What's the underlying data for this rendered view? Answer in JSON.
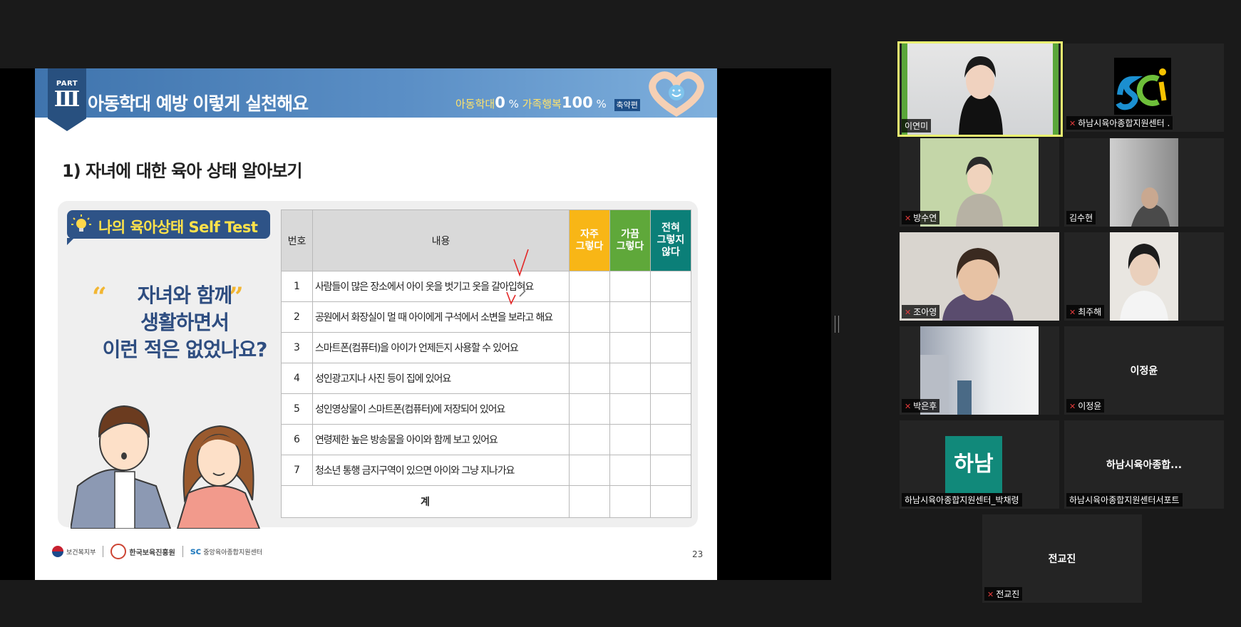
{
  "slide": {
    "part_label": "PART",
    "part_number": "Ⅲ",
    "title": "아동학대 예방 이렇게 실천해요",
    "motto": {
      "term1": "아동학대",
      "value1": "0",
      "unit1": "%",
      "term2": "가족행복",
      "value2": "100",
      "unit2": "%",
      "tag": "축약편"
    },
    "section_title": "1) 자녀에 대한 육아 상태 알아보기",
    "badge_text": "나의 육아상태 Self Test",
    "quote_lines": [
      "자녀와 함께",
      "생활하면서",
      "이런 적은 없었나요?"
    ],
    "quote_open": "“",
    "quote_close": "”",
    "table": {
      "col_number": "번호",
      "col_content": "내용",
      "col_often_1": "자주",
      "col_often_2": "그렇다",
      "col_sometimes_1": "가끔",
      "col_sometimes_2": "그렇다",
      "col_never_1": "전혀",
      "col_never_2": "그렇지",
      "col_never_3": "않다",
      "rows": [
        {
          "num": "1",
          "text": "사람들이 많은 장소에서 아이 옷을 벗기고 옷을 갈아입혀요"
        },
        {
          "num": "2",
          "text": "공원에서 화장실이 멀 때 아이에게 구석에서 소변을 보라고 해요"
        },
        {
          "num": "3",
          "text": "스마트폰(컴퓨터)을 아이가 언제든지 사용할 수 있어요"
        },
        {
          "num": "4",
          "text": "성인광고지나 사진 등이 집에 있어요"
        },
        {
          "num": "5",
          "text": "성인영상물이 스마트폰(컴퓨터)에 저장되어 있어요"
        },
        {
          "num": "6",
          "text": "연령제한 높은 방송물을 아이와 함께 보고 있어요"
        },
        {
          "num": "7",
          "text": "청소년 통행 금지구역이 있으면 아이와 그냥 지나가요"
        }
      ],
      "total_label": "계",
      "colors": {
        "often": "#f8b616",
        "sometimes": "#5fa83a",
        "never": "#0b7f78"
      }
    },
    "footer": {
      "logo1": "보건복지부",
      "logo2": "한국보육진흥원",
      "logo3": "중앙육아종합지원센터"
    },
    "page_number": "23"
  },
  "participants": [
    {
      "name": "이연미",
      "muted": false,
      "video": true,
      "active": true
    },
    {
      "name": "하남시육아종합지원센터 .",
      "muted": true,
      "video": true,
      "active": false
    },
    {
      "name": "방수연",
      "muted": true,
      "video": true,
      "active": false
    },
    {
      "name": "김수현",
      "muted": false,
      "video": true,
      "active": false
    },
    {
      "name": "조아영",
      "muted": true,
      "video": true,
      "active": false
    },
    {
      "name": "최주해",
      "muted": true,
      "video": true,
      "active": false
    },
    {
      "name": "박은후",
      "muted": true,
      "video": true,
      "active": false
    },
    {
      "name": "이정윤",
      "muted": true,
      "video": false,
      "display": "이정윤",
      "active": false
    },
    {
      "name": "하남시육아종합지원센터_박채령",
      "muted": false,
      "video": false,
      "avatar": "하남",
      "active": false
    },
    {
      "name": "하남시육아종합지원센터서포트",
      "muted": false,
      "video": false,
      "display": "하남시육아종합...",
      "active": false
    },
    {
      "name": "전교진",
      "muted": true,
      "video": false,
      "display": "전교진",
      "active": false
    }
  ],
  "icons": {
    "mute": "mic-off-icon",
    "bulb": "lightbulb-icon",
    "hearts": "heart-hands-icon"
  }
}
